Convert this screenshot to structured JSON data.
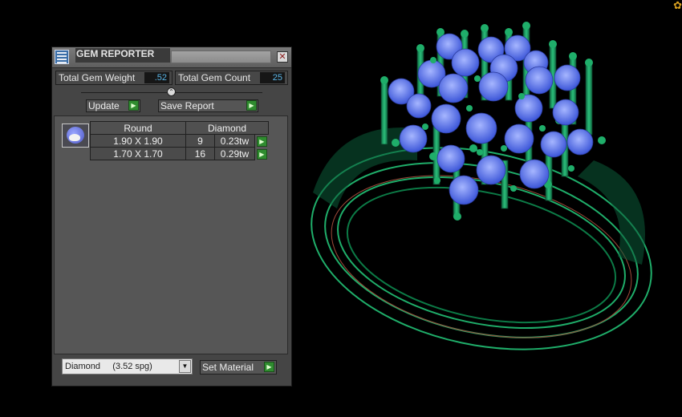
{
  "panel": {
    "title": "GEM REPORTER",
    "close_icon": "close-icon",
    "stats": {
      "weight_label": "Total Gem Weight",
      "weight_value": ".52",
      "count_label": "Total Gem Count",
      "count_value": "25"
    },
    "buttons": {
      "update_label": "Update",
      "save_report_label": "Save Report",
      "set_material_label": "Set Material"
    },
    "table": {
      "shape_header": "Round",
      "material_header": "Diamond",
      "rows": [
        {
          "size": "1.90 X 1.90",
          "count": "9",
          "weight": "0.23tw"
        },
        {
          "size": "1.70 X 1.70",
          "count": "16",
          "weight": "0.29tw"
        }
      ]
    },
    "material_select": {
      "value": "Diamond     (3.52 spg)"
    }
  },
  "colors": {
    "ring_green": "#1fae6a",
    "gem_blue": "#4a63e0",
    "value_blue": "#5ab6e8",
    "button_green": "#2f8c2f"
  }
}
